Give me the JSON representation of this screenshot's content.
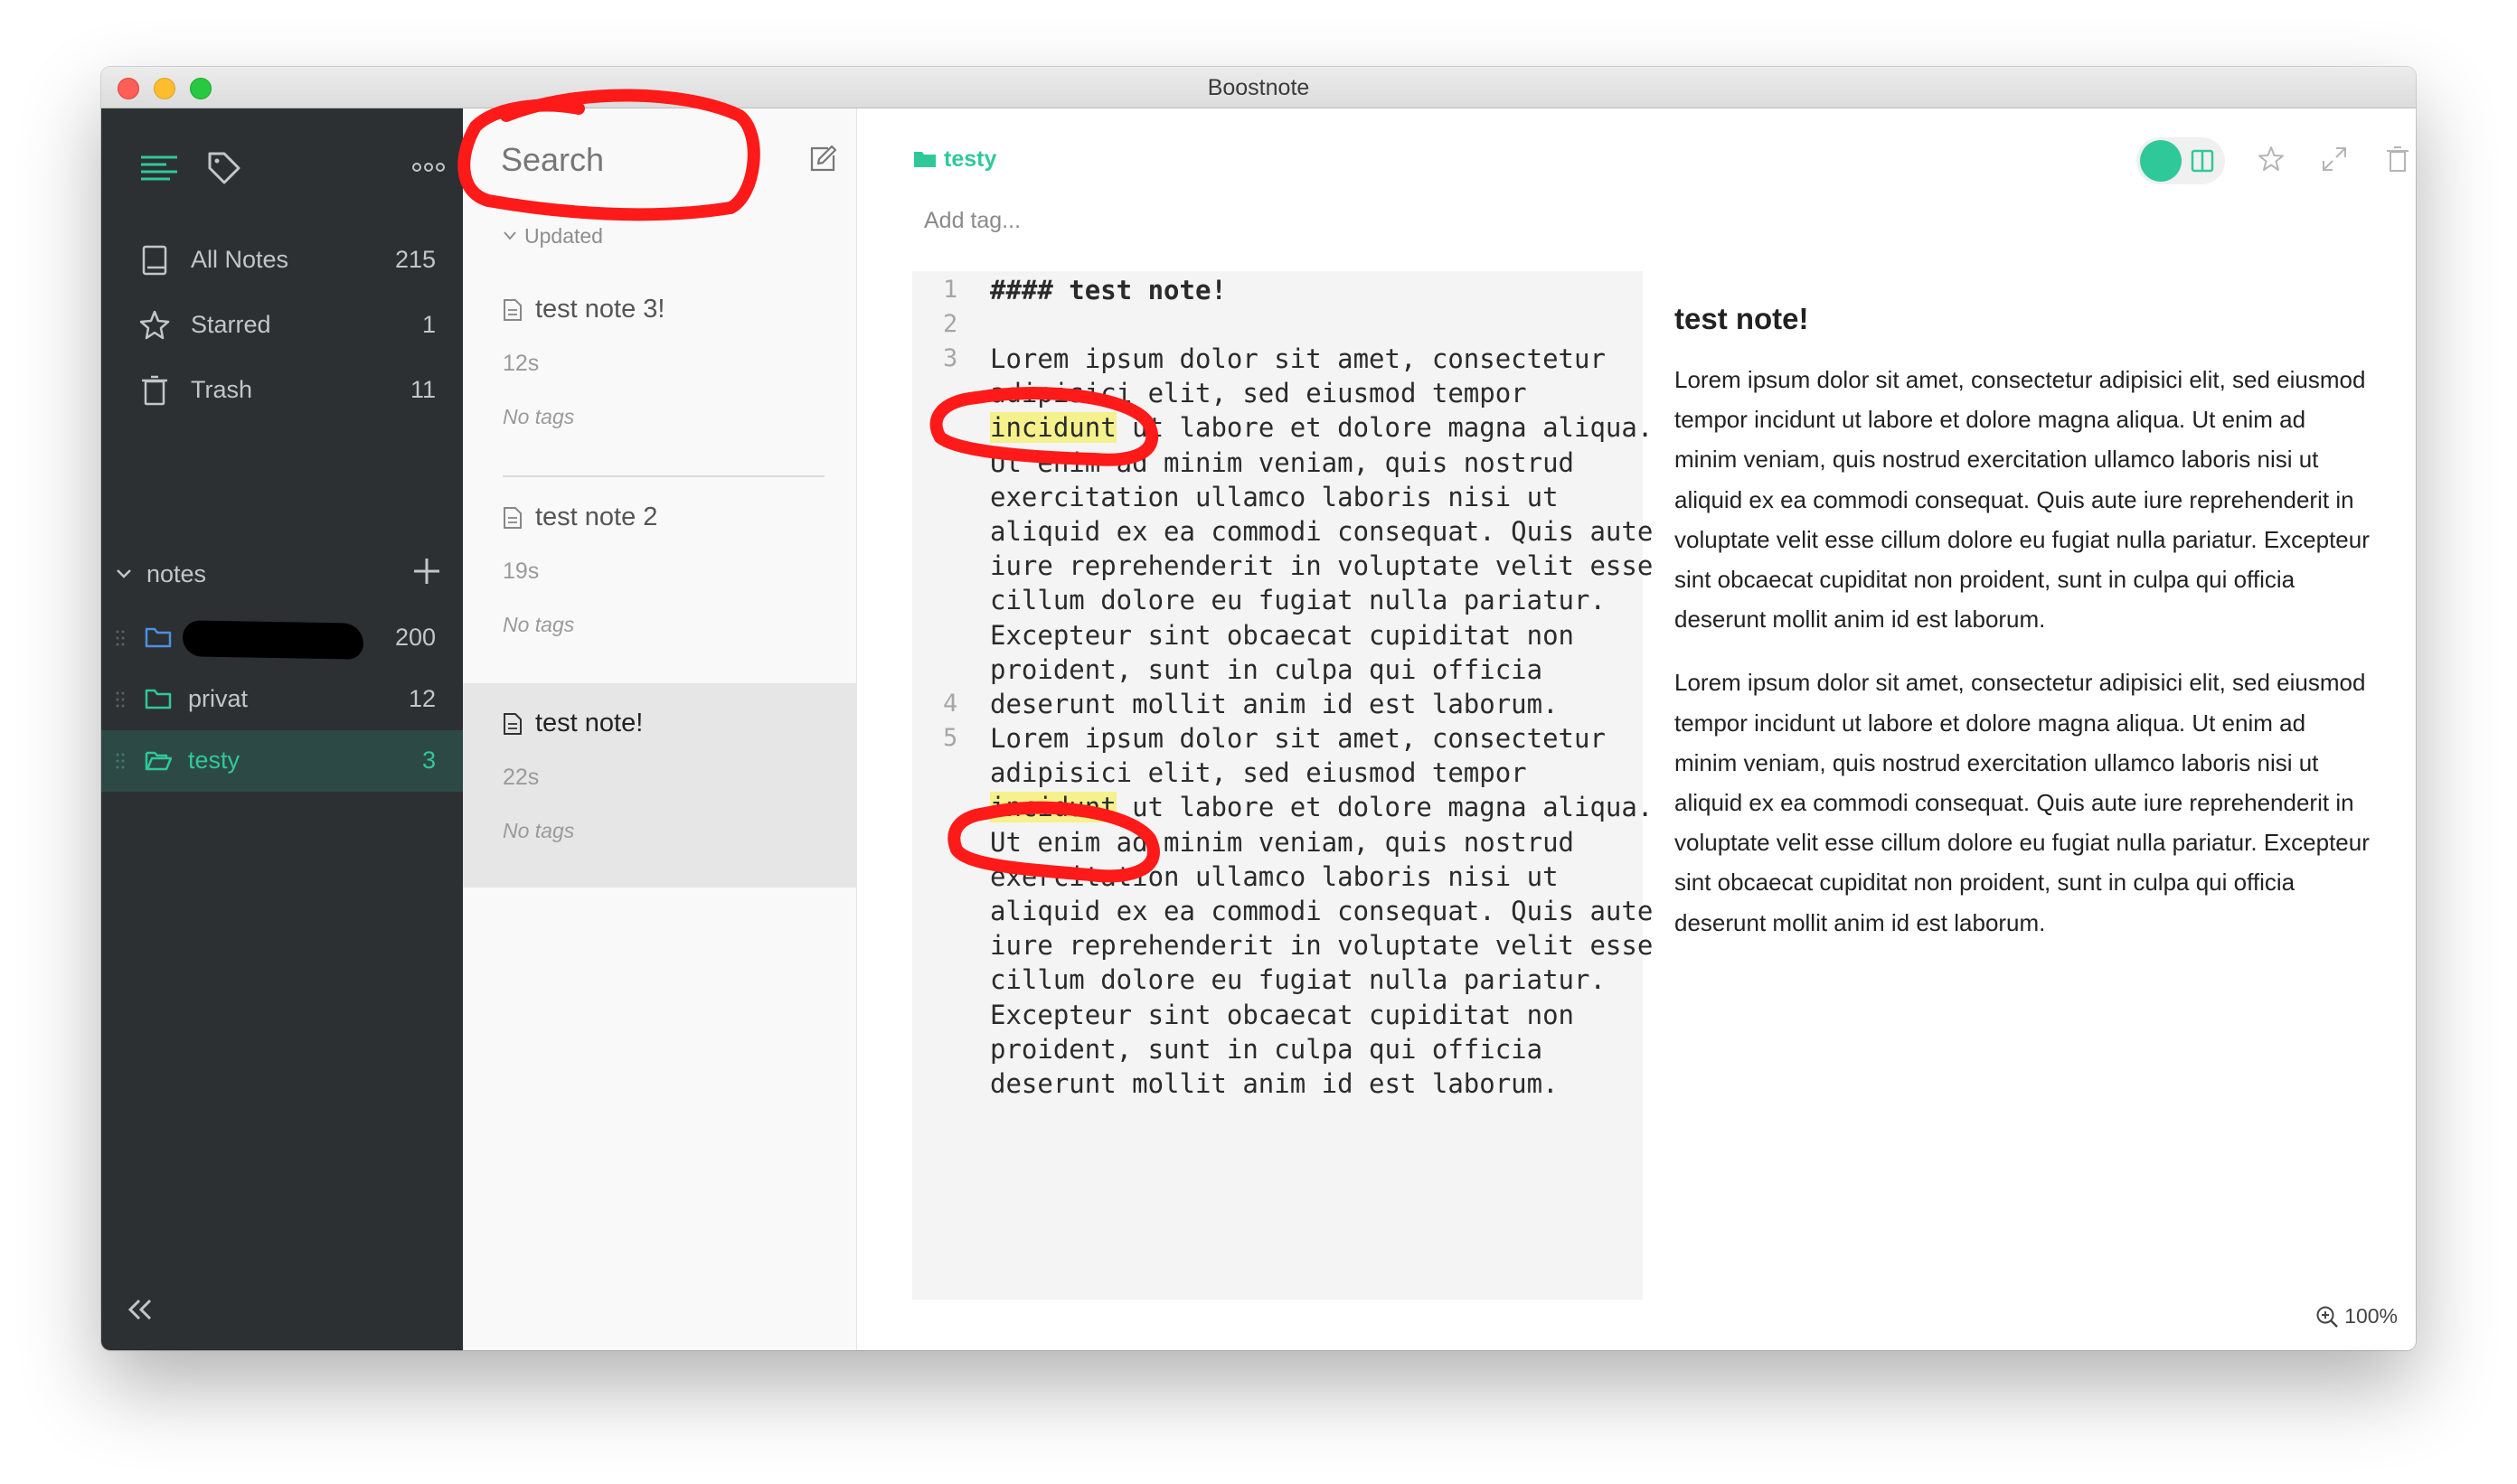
{
  "window": {
    "title": "Boostnote"
  },
  "sidebar": {
    "nav": [
      {
        "label": "All Notes",
        "count": "215"
      },
      {
        "label": "Starred",
        "count": "1"
      },
      {
        "label": "Trash",
        "count": "11"
      }
    ],
    "folders_header": "notes",
    "folders": [
      {
        "name": "",
        "count": "200"
      },
      {
        "name": "privat",
        "count": "12"
      },
      {
        "name": "testy",
        "count": "3"
      }
    ]
  },
  "notelist": {
    "search_placeholder": "Search",
    "sort_label": "Updated",
    "notes": [
      {
        "title": "test note 3!",
        "time": "12s",
        "tags": "No tags"
      },
      {
        "title": "test note 2",
        "time": "19s",
        "tags": "No tags"
      },
      {
        "title": "test note!",
        "time": "22s",
        "tags": "No tags"
      }
    ]
  },
  "main": {
    "folder": "testy",
    "add_tag": "Add tag...",
    "zoom": "100%",
    "editor": {
      "line_numbers": [
        "1",
        "2",
        "3",
        "4",
        "5"
      ],
      "heading_line": "#### test note!",
      "p1_before": "Lorem ipsum dolor sit amet, consectetur\nadipisici elit, sed eiusmod tempor\n",
      "p1_highlight": "incidunt",
      "p1_after": " ut labore et dolore magna aliqua.\nUt enim ad minim veniam, quis nostrud\nexercitation ullamco laboris nisi ut\naliquid ex ea commodi consequat. Quis aute\niure reprehenderit in voluptate velit esse\ncillum dolore eu fugiat nulla pariatur.\nExcepteur sint obcaecat cupiditat non\nproident, sunt in culpa qui officia\ndeserunt mollit anim id est laborum.",
      "p2_before": "Lorem ipsum dolor sit amet, consectetur\nadipisici elit, sed eiusmod tempor\n",
      "p2_highlight": "incidunt",
      "p2_after": " ut labore et dolore magna aliqua.\nUt enim ad minim veniam, quis nostrud\nexercitation ullamco laboris nisi ut\naliquid ex ea commodi consequat. Quis aute\niure reprehenderit in voluptate velit esse\ncillum dolore eu fugiat nulla pariatur.\nExcepteur sint obcaecat cupiditat non\nproident, sunt in culpa qui officia\ndeserunt mollit anim id est laborum."
    },
    "preview": {
      "heading": "test note!",
      "paragraphs": [
        "Lorem ipsum dolor sit amet, consectetur adipisici elit, sed eiusmod tempor incidunt ut labore et dolore magna aliqua. Ut enim ad minim veniam, quis nostrud exercitation ullamco laboris nisi ut aliquid ex ea commodi consequat. Quis aute iure reprehenderit in voluptate velit esse cillum dolore eu fugiat nulla pariatur. Excepteur sint obcaecat cupiditat non proident, sunt in culpa qui officia deserunt mollit anim id est laborum.",
        "Lorem ipsum dolor sit amet, consectetur adipisici elit, sed eiusmod tempor incidunt ut labore et dolore magna aliqua. Ut enim ad minim veniam, quis nostrud exercitation ullamco laboris nisi ut aliquid ex ea commodi consequat. Quis aute iure reprehenderit in voluptate velit esse cillum dolore eu fugiat nulla pariatur. Excepteur sint obcaecat cupiditat non proident, sunt in culpa qui officia deserunt mollit anim id est laborum."
      ]
    }
  },
  "colors": {
    "accent": "#2fc999",
    "sidebar_bg": "#2c3033",
    "annotation": "#ff1a1a",
    "highlight": "#f5f18c"
  }
}
